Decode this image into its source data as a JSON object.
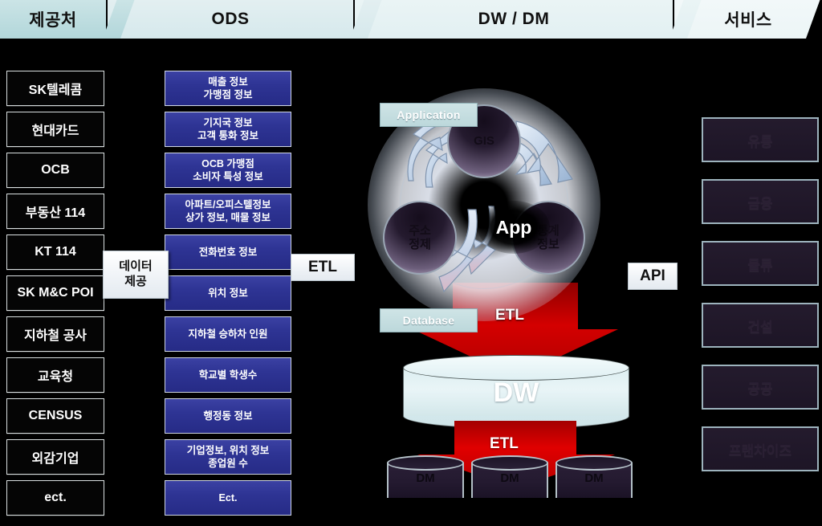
{
  "header": {
    "tabs": [
      {
        "label": "제공처"
      },
      {
        "label": "ODS"
      },
      {
        "label": "DW / DM"
      },
      {
        "label": "서비스"
      }
    ]
  },
  "providers": {
    "items": [
      {
        "label": "SK텔레콤"
      },
      {
        "label": "현대카드"
      },
      {
        "label": "OCB"
      },
      {
        "label": "부동산 114"
      },
      {
        "label": "KT 114"
      },
      {
        "label": "SK M&C POI"
      },
      {
        "label": "지하철 공사"
      },
      {
        "label": "교육청"
      },
      {
        "label": "CENSUS"
      },
      {
        "label": "외감기업"
      },
      {
        "label": "ect."
      }
    ]
  },
  "ods": {
    "items": [
      {
        "line1": "매출 정보",
        "line2": "가맹점 정보"
      },
      {
        "line1": "기지국 정보",
        "line2": "고객 통화 정보"
      },
      {
        "line1": "OCB 가맹점",
        "line2": "소비자 특성 정보"
      },
      {
        "line1": "아파트/오피스텔정보",
        "line2": "상가 정보, 매물 정보"
      },
      {
        "line1": "전화번호 정보",
        "line2": ""
      },
      {
        "line1": "위치 정보",
        "line2": ""
      },
      {
        "line1": "지하철 승하차 인원",
        "line2": ""
      },
      {
        "line1": "학교별 학생수",
        "line2": ""
      },
      {
        "line1": "행정동 정보",
        "line2": ""
      },
      {
        "line1": "기업정보, 위치 정보",
        "line2": "종업원 수"
      },
      {
        "line1": "Ect.",
        "line2": ""
      }
    ]
  },
  "callouts": {
    "data_provide_line1": "데이터",
    "data_provide_line2": "제공",
    "etl_ods_to_dw": "ETL",
    "api": "API"
  },
  "center": {
    "tag_application": "Application",
    "tag_database": "Database",
    "node_gis": "GIS",
    "node_app": "App",
    "node_address_line1": "주소",
    "node_address_line2": "정제",
    "node_stats_line1": "통계",
    "node_stats_line2": "정보",
    "etl_app_to_dw": "ETL",
    "dw_label": "DW",
    "etl_dw_to_dm": "ETL",
    "dm_labels": [
      "DM",
      "DM",
      "DM"
    ]
  },
  "services": {
    "items": [
      {
        "label": "유통"
      },
      {
        "label": "금융"
      },
      {
        "label": "물류"
      },
      {
        "label": "건설"
      },
      {
        "label": "공공"
      },
      {
        "label": "프랜차이즈"
      }
    ]
  },
  "colors": {
    "background": "#000000",
    "tab_active": "#b8dadd",
    "tab_inactive": "#e3eff1",
    "ods_blue": "#2e3494",
    "etl_red": "#cc0000",
    "service_purple": "#241b2d",
    "tag_teal": "#c6dfe2"
  }
}
